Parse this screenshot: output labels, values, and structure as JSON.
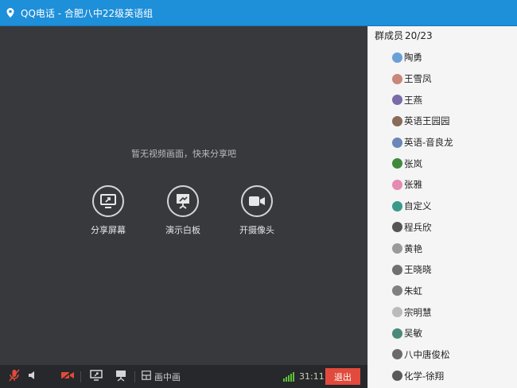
{
  "window": {
    "title": "QQ电话 - 合肥八中22级英语组"
  },
  "stage": {
    "hint": "暂无视频画面，快来分享吧",
    "actions": [
      {
        "label": "分享屏幕",
        "icon": "share-screen-icon"
      },
      {
        "label": "演示白板",
        "icon": "whiteboard-icon"
      },
      {
        "label": "开摄像头",
        "icon": "camera-icon"
      }
    ]
  },
  "toolbar": {
    "items": [
      {
        "icon": "microphone-muted-icon"
      },
      {
        "icon": "speaker-icon"
      },
      {
        "icon": "camera-off-icon"
      },
      {
        "icon": "screen-share-icon"
      },
      {
        "icon": "whiteboard-icon"
      },
      {
        "icon": "layout-icon",
        "label": "画中画"
      }
    ],
    "timer": "31:11",
    "exit_label": "退出",
    "colors": {
      "exit": "#e14a3c",
      "signal": "#5fbf3a",
      "muted": "#e14a3c"
    }
  },
  "members_panel": {
    "title": "群成员",
    "count": "20/23",
    "members": [
      {
        "name": "陶勇",
        "avatar_color": "#6aa0d8"
      },
      {
        "name": "王雪凤",
        "avatar_color": "#c9877a"
      },
      {
        "name": "王燕",
        "avatar_color": "#7a6aa8"
      },
      {
        "name": "英语王园园",
        "avatar_color": "#8a6a58"
      },
      {
        "name": "英语-音良龙",
        "avatar_color": "#6b86b8"
      },
      {
        "name": "张岚",
        "avatar_color": "#3f8a3c"
      },
      {
        "name": "张雅",
        "avatar_color": "#e58ab0"
      },
      {
        "name": "自定义",
        "avatar_color": "#3a9a8a"
      },
      {
        "name": "程兵欣",
        "avatar_color": "#555555"
      },
      {
        "name": "黄艳",
        "avatar_color": "#9a9a9a"
      },
      {
        "name": "王晓晓",
        "avatar_color": "#707070"
      },
      {
        "name": "朱虹",
        "avatar_color": "#808080"
      },
      {
        "name": "宗明慧",
        "avatar_color": "#bbbbbb"
      },
      {
        "name": "吴敏",
        "avatar_color": "#4a8a7a"
      },
      {
        "name": "八中唐俊松",
        "avatar_color": "#6a6a6a"
      },
      {
        "name": "化学-徐翔",
        "avatar_color": "#5a5a5a"
      }
    ]
  }
}
